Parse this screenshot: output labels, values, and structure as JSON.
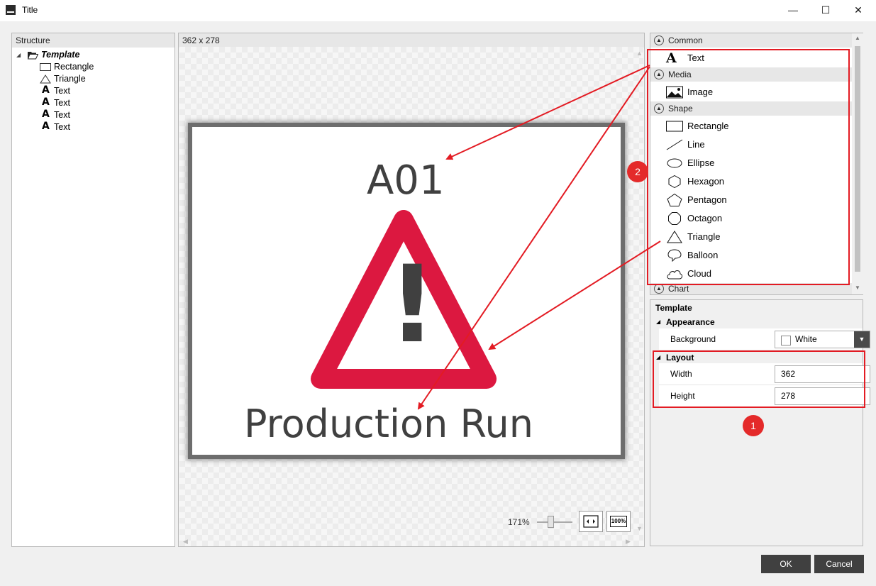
{
  "window": {
    "title": "Title",
    "minimize_glyph": "—",
    "maximize_glyph": "☐",
    "close_glyph": "✕"
  },
  "structure": {
    "header": "Structure",
    "root": "Template",
    "items": [
      "Rectangle",
      "Triangle",
      "Text",
      "Text",
      "Text",
      "Text"
    ]
  },
  "canvas": {
    "size_label": "362 x 278",
    "title_text": "A01",
    "subtitle_text": "Production Run",
    "warning_mark": "!",
    "zoom_label": "171%",
    "fit_label": "⇹",
    "actual_size_label": "100%"
  },
  "toolbox": {
    "categories": {
      "common": "Common",
      "media": "Media",
      "shape": "Shape",
      "chart": "Chart"
    },
    "common_items": [
      "Text"
    ],
    "media_items": [
      "Image"
    ],
    "shape_items": [
      "Rectangle",
      "Line",
      "Ellipse",
      "Hexagon",
      "Pentagon",
      "Octagon",
      "Triangle",
      "Balloon",
      "Cloud"
    ]
  },
  "properties": {
    "title": "Template",
    "appearance": "Appearance",
    "background_label": "Background",
    "background_value": "White",
    "layout": "Layout",
    "width_label": "Width",
    "width_value": "362",
    "height_label": "Height",
    "height_value": "278"
  },
  "buttons": {
    "ok": "OK",
    "cancel": "Cancel"
  },
  "annotations": {
    "badge_1": "1",
    "badge_2": "2",
    "color": "#e31b23"
  },
  "colors": {
    "warning_red": "#dc1840",
    "mark_gray": "#404040"
  }
}
